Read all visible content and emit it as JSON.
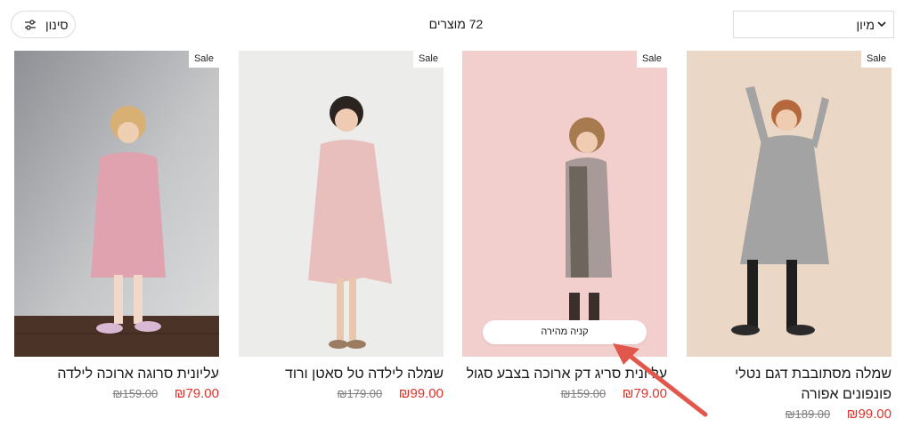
{
  "toolbar": {
    "sort_label": "מיון",
    "product_count": "72 מוצרים",
    "filter_label": "סינון"
  },
  "products": [
    {
      "title": "עליונית סרוגה ארוכה לילדה",
      "price": "₪79.00",
      "compare_price": "₪159.00",
      "badge": "Sale"
    },
    {
      "title": "שמלה לילדה טל סאטן ורוד",
      "price": "₪99.00",
      "compare_price": "₪179.00",
      "badge": "Sale"
    },
    {
      "title": "עליונית סריג דק ארוכה בצבע סגול",
      "price": "₪79.00",
      "compare_price": "₪159.00",
      "badge": "Sale",
      "quick_buy_label": "קניה מהירה"
    },
    {
      "title": "שמלה מסתובבת דגם נטלי פונפונים אפורה",
      "price": "₪99.00",
      "compare_price": "₪189.00",
      "badge": "Sale"
    }
  ],
  "colors": {
    "sale_price": "#e0332b",
    "compare_price": "#808080",
    "annotation_arrow": "#e2574c"
  },
  "icons": {
    "sort": "chevron-down-icon",
    "filter": "sliders-icon"
  }
}
